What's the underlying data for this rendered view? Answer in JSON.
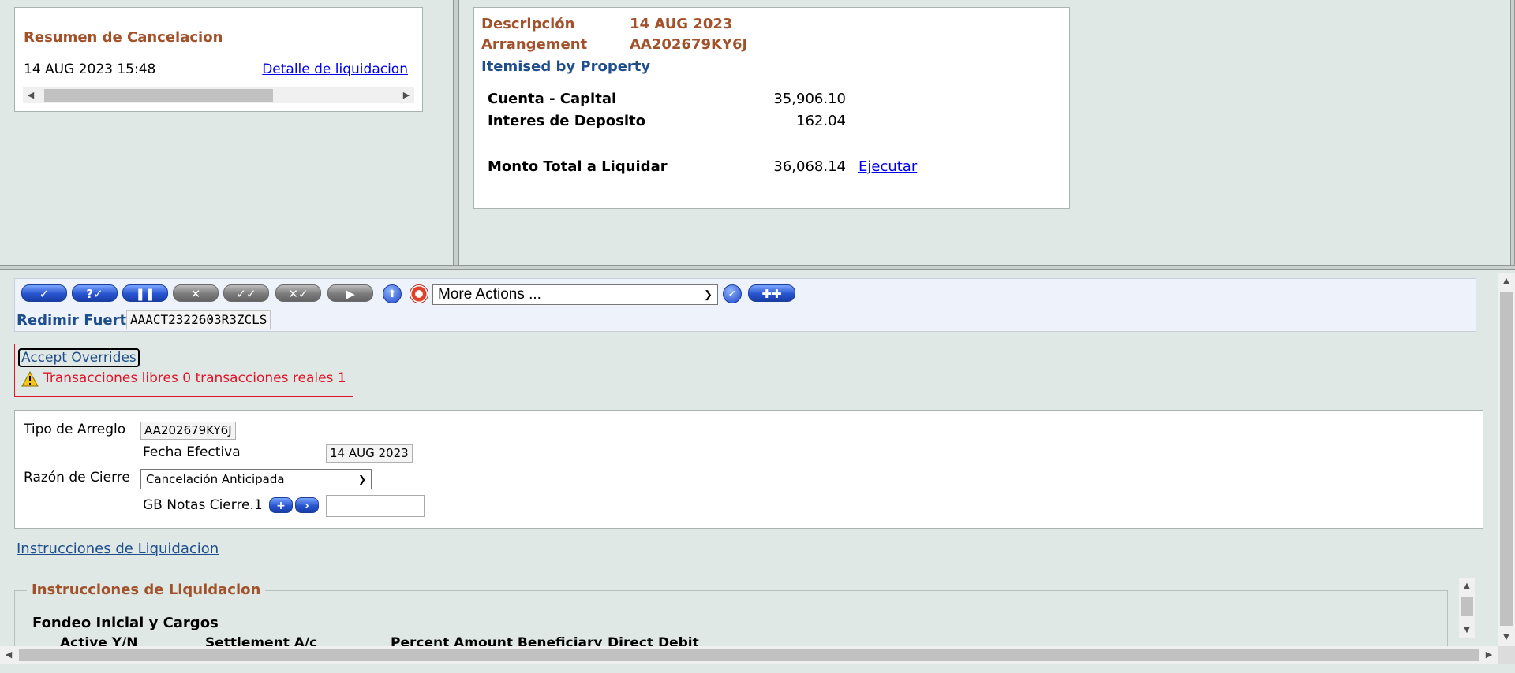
{
  "summary": {
    "title": "Resumen de Cancelacion",
    "datetime": "14 AUG 2023 15:48",
    "detail_link": "Detalle de liquidacion"
  },
  "detail": {
    "descripcion_label": "Descripción",
    "descripcion_value": "14 AUG 2023",
    "arrangement_label": "Arrangement",
    "arrangement_value": "AA202679KY6J",
    "itemised": "Itemised by Property",
    "rows": [
      {
        "label": "Cuenta - Capital",
        "value": "35,906.10"
      },
      {
        "label": "Interes de Deposito",
        "value": "162.04"
      },
      {
        "label": "Monto Total a Liquidar",
        "value": "36,068.14"
      }
    ],
    "execute_link": "Ejecutar"
  },
  "toolbar": {
    "more_actions": "More Actions ...",
    "redimir_label": "Redimir Fuerte",
    "redimir_value": "AAACT2322603R3ZCLS"
  },
  "override": {
    "accept": "Accept Overrides",
    "message": "Transacciones libres 0 transacciones reales 1"
  },
  "form": {
    "tipo_label": "Tipo de Arreglo",
    "tipo_value": "AA202679KY6J",
    "fecha_label": "Fecha Efectiva",
    "fecha_value": "14 AUG 2023",
    "razon_label": "Razón de Cierre",
    "razon_value": "Cancelación Anticipada",
    "notas_label": "GB Notas Cierre.1"
  },
  "instrucciones": {
    "link": "Instrucciones de Liquidacion",
    "legend": "Instrucciones de Liquidacion",
    "subtitle": "Fondeo Inicial y Cargos",
    "columns": [
      "Active Y/N",
      "Settlement A/c",
      "Percent Amount Beneficiary",
      "Direct Debit"
    ]
  },
  "colors": {
    "accent_brown": "#a1522a",
    "link_blue": "#1f4e8c",
    "warning_red": "#e0142a"
  }
}
